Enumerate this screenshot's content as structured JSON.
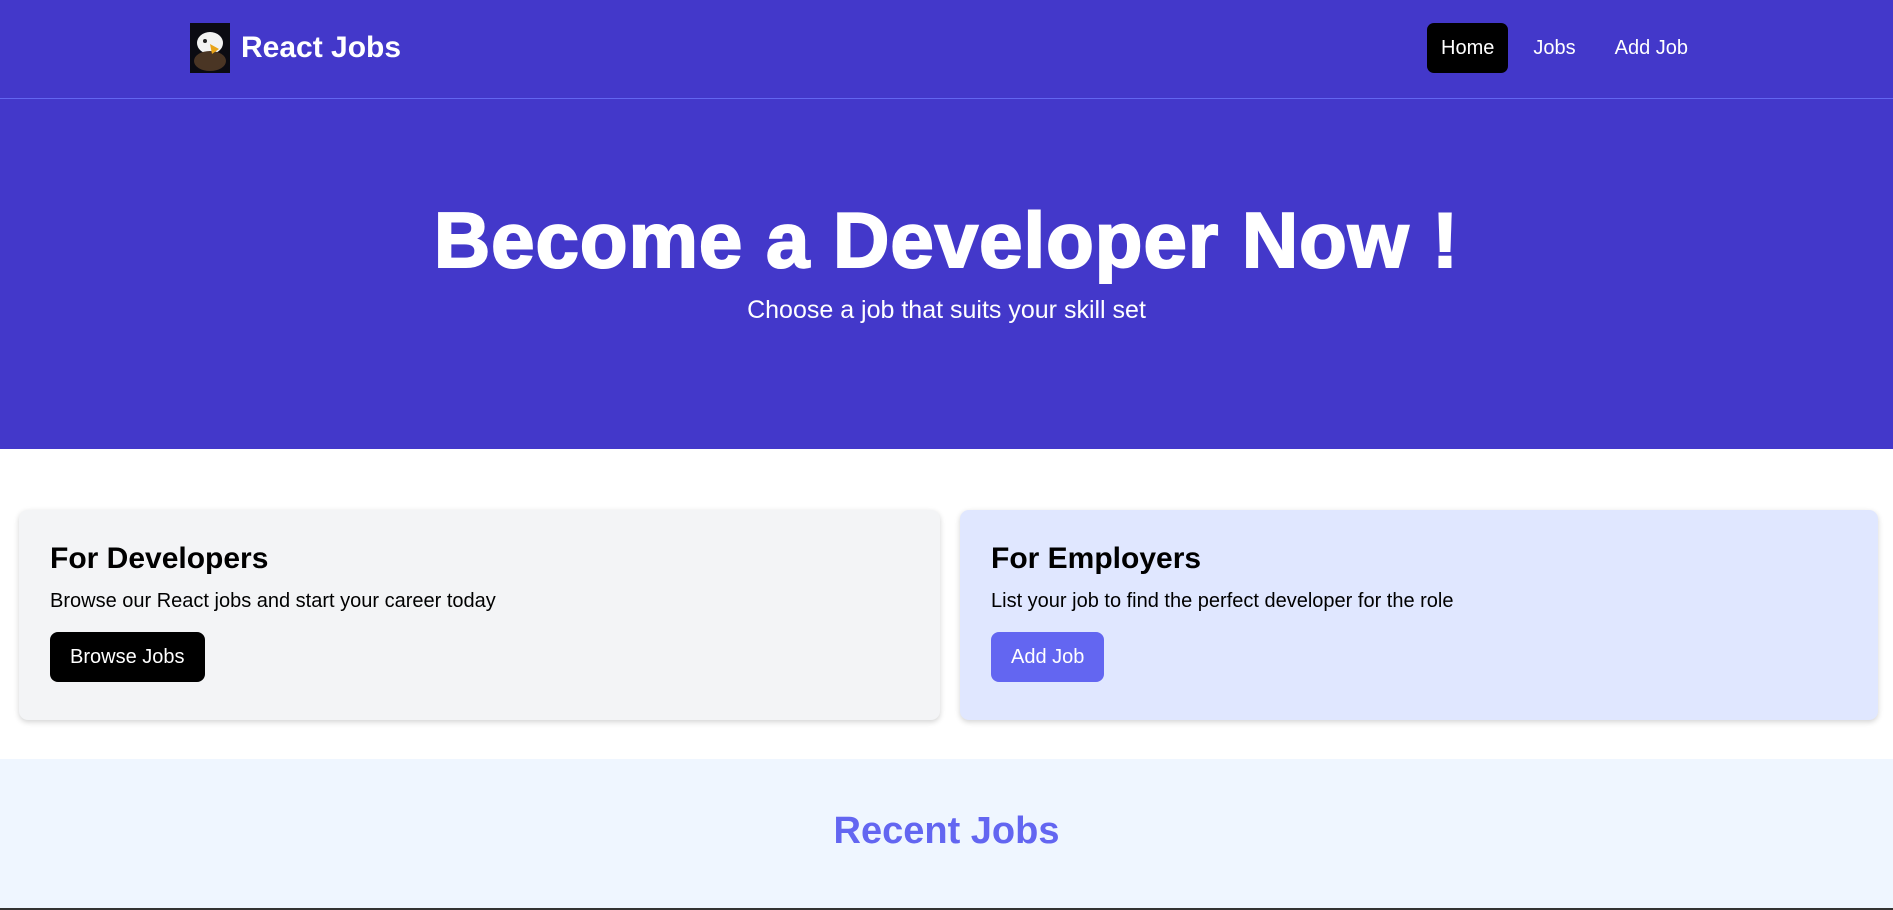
{
  "nav": {
    "brand": "React Jobs",
    "logo_icon": "eagle-logo-icon",
    "links": [
      {
        "label": "Home",
        "active": true
      },
      {
        "label": "Jobs",
        "active": false
      },
      {
        "label": "Add Job",
        "active": false
      }
    ]
  },
  "hero": {
    "title": "Become a Developer Now !",
    "subtitle": "Choose a job that suits your skill set"
  },
  "cards": {
    "developers": {
      "title": "For Developers",
      "text": "Browse our React jobs and start your career today",
      "button": "Browse Jobs"
    },
    "employers": {
      "title": "For Employers",
      "text": "List your job to find the perfect developer for the role",
      "button": "Add Job"
    }
  },
  "recent": {
    "title": "Recent Jobs"
  },
  "colors": {
    "primary": "#4338ca",
    "accent": "#6366f1",
    "card_gray": "#f3f4f6",
    "card_indigo": "#e0e7ff",
    "recent_bg": "#eff6ff"
  }
}
